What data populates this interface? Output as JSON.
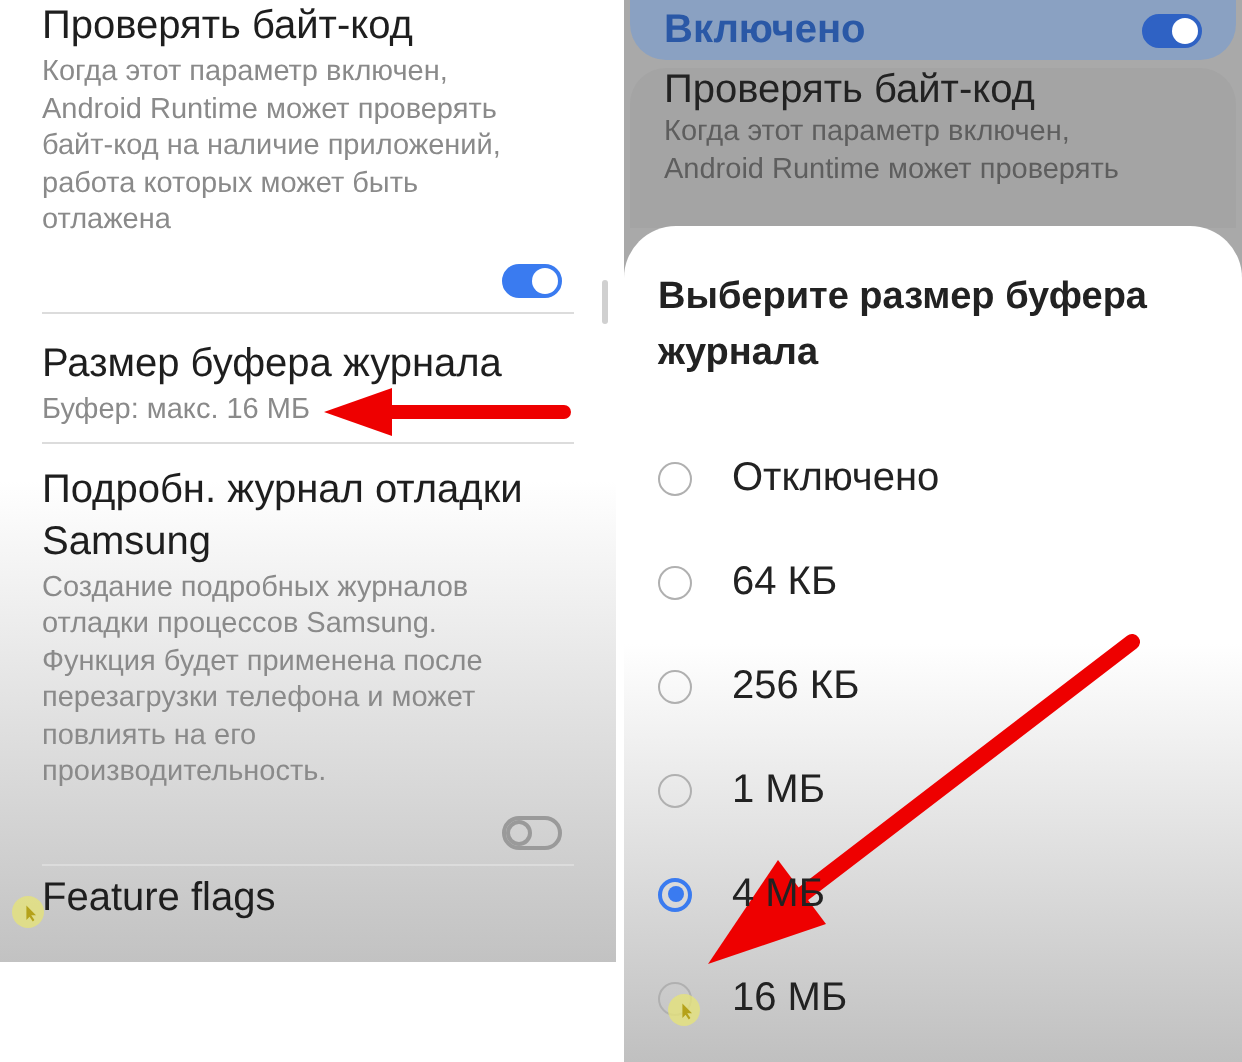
{
  "left_screen": {
    "items": [
      {
        "kind": "toggle",
        "title": "Проверять байт-код",
        "description": "Когда этот параметр включен, Android Runtime может проверять байт-код на наличие приложений, работа которых может быть отлажена",
        "on": true
      },
      {
        "kind": "value",
        "title": "Размер буфера журнала",
        "summary": "Буфер: макс. 16 МБ"
      },
      {
        "kind": "toggle",
        "title": "Подробн. журнал отладки Samsung",
        "description": "Создание подробных журналов отладки процессов Samsung. Функция будет применена после перезагрузки телефона и может повлиять на его производительность.",
        "on": false
      },
      {
        "kind": "heading",
        "title": "Feature flags"
      }
    ]
  },
  "right_screen": {
    "master_switch": {
      "label": "Включено",
      "on": true
    },
    "background_item": {
      "title": "Проверять байт-код",
      "description": "Когда этот параметр включен, Android Runtime может проверять"
    },
    "dialog": {
      "title": "Выберите размер буфера журнала",
      "options": [
        {
          "label": "Отключено",
          "selected": false
        },
        {
          "label": "64 КБ",
          "selected": false
        },
        {
          "label": "256 КБ",
          "selected": false
        },
        {
          "label": "1 МБ",
          "selected": false
        },
        {
          "label": "4 МБ",
          "selected": true
        },
        {
          "label": "16 МБ",
          "selected": false
        }
      ]
    }
  }
}
